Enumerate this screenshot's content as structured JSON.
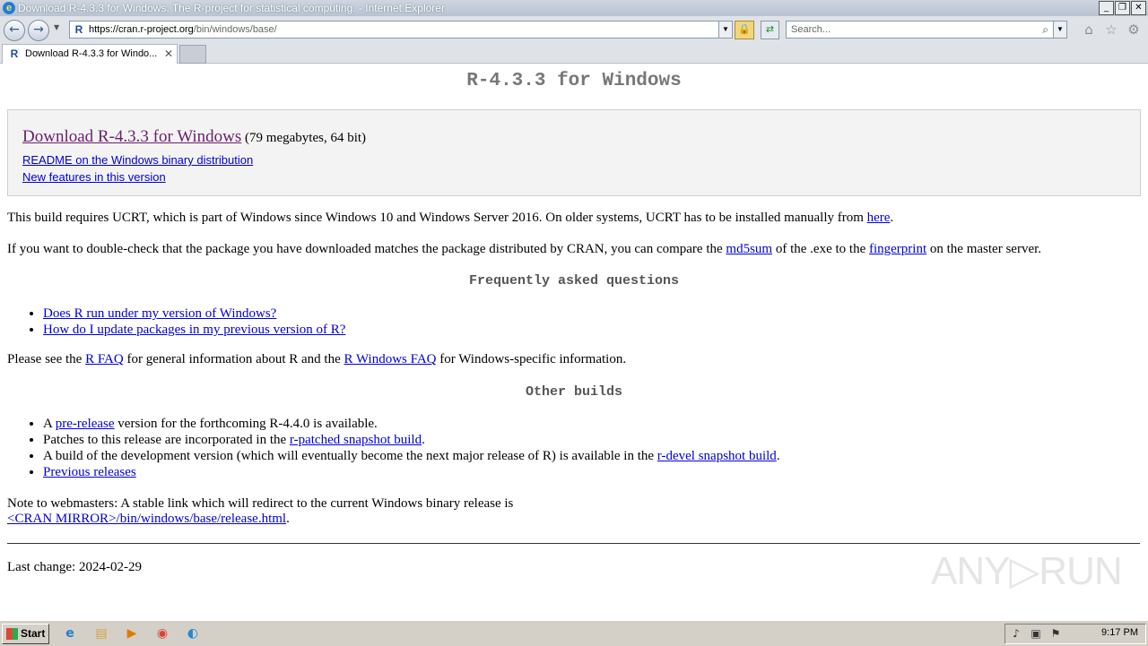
{
  "window": {
    "title": "Download R-4.3.3 for Windows. The R-project for statistical computing. - Internet Explorer",
    "minimize": "_",
    "restore": "❐",
    "close": "✕"
  },
  "nav": {
    "back_icon": "←",
    "forward_icon": "→",
    "dropdown_icon": "▼",
    "url_host": "https://cran.r-project.org",
    "url_path": "/bin/windows/base/",
    "favicon": "R",
    "lock_icon": "🔒",
    "refresh_icon": "⇄",
    "search_placeholder": "Search...",
    "search_icon": "⌕",
    "home_icon": "⌂",
    "star_icon": "☆",
    "gear_icon": "⚙"
  },
  "tab": {
    "label": "Download R-4.3.3 for Windo...",
    "close": "✕"
  },
  "page": {
    "title": "R-4.3.3 for Windows",
    "download_link": "Download R-4.3.3 for Windows",
    "download_meta": " (79 megabytes, 64 bit)",
    "readme_link": "README on the Windows binary distribution",
    "newfeatures_link": "New features in this version",
    "ucrt_text": "This build requires UCRT, which is part of Windows since Windows 10 and Windows Server 2016. On older systems, UCRT has to be installed manually from ",
    "ucrt_link": "here",
    "ucrt_end": ".",
    "check_text_1": "If you want to double-check that the package you have downloaded matches the package distributed by CRAN, you can compare the ",
    "md5_link": "md5sum",
    "check_text_2": " of the .exe to the ",
    "fingerprint_link": "fingerprint",
    "check_text_3": " on the master server.",
    "faq_heading": "Frequently asked questions",
    "faq_items": [
      "Does R run under my version of Windows?",
      "How do I update packages in my previous version of R?"
    ],
    "see_text_1": "Please see the ",
    "rfaq_link": "R FAQ",
    "see_text_2": " for general information about R and the ",
    "rwinfaq_link": "R Windows FAQ",
    "see_text_3": " for Windows-specific information.",
    "other_heading": "Other builds",
    "ob1_a": "A ",
    "ob1_link": "pre-release",
    "ob1_b": " version for the forthcoming R-4.4.0 is available.",
    "ob2_a": "Patches to this release are incorporated in the ",
    "ob2_link": "r-patched snapshot build",
    "ob2_b": ".",
    "ob3_a": "A build of the development version (which will eventually become the next major release of R) is available in the ",
    "ob3_link": "r-devel snapshot build",
    "ob3_b": ".",
    "ob4_link": "Previous releases",
    "note_text": "Note to webmasters: A stable link which will redirect to the current Windows binary release is",
    "note_link": "<CRAN MIRROR>/bin/windows/base/release.html",
    "note_end": ".",
    "last_change": "Last change: 2024-02-29"
  },
  "watermark": "ANY▷RUN",
  "taskbar": {
    "start": "Start",
    "clock": "9:17 PM",
    "icons": [
      "internet-explorer",
      "file-explorer",
      "media-player",
      "chrome",
      "edge"
    ]
  }
}
